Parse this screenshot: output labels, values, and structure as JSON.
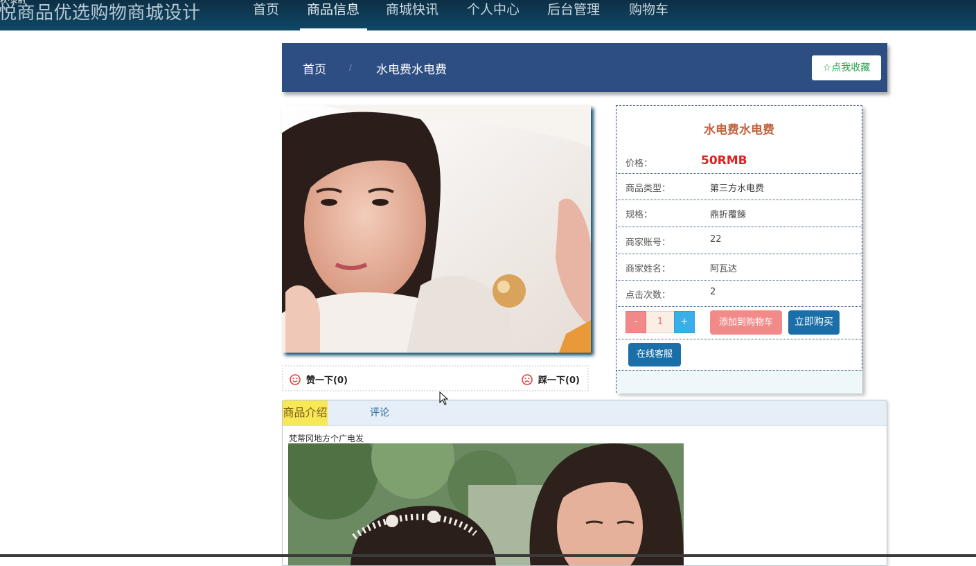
{
  "topbar": {
    "tiny_label": "秋·录制",
    "site_title": "悦商品优选购物商城设计",
    "nav": [
      {
        "label": "首页"
      },
      {
        "label": "商品信息"
      },
      {
        "label": "商城快讯"
      },
      {
        "label": "个人中心"
      },
      {
        "label": "后台管理"
      },
      {
        "label": "购物车"
      }
    ],
    "active_index": 1
  },
  "breadcrumb": {
    "home": "首页",
    "separator": "/",
    "current": "水电费水电费",
    "favorite_button": "☆点我收藏"
  },
  "votes": {
    "like": "赞一下(0)",
    "dislike": "踩一下(0)"
  },
  "product": {
    "title": "水电费水电费",
    "price_label": "价格：",
    "price_value": "50RMB",
    "fields": [
      {
        "label": "商品类型：",
        "value": "第三方水电费"
      },
      {
        "label": "规格：",
        "value": "鼎折覆餗"
      },
      {
        "label": "商家账号：",
        "value": "22"
      },
      {
        "label": "商家姓名：",
        "value": "阿瓦达"
      },
      {
        "label": "点击次数：",
        "value": "2"
      }
    ],
    "qty_minus": "-",
    "qty_value": "1",
    "qty_plus": "+",
    "add_to_cart": "添加到购物车",
    "buy_now": "立即购买",
    "online_service": "在线客服"
  },
  "tabs": {
    "intro_label": "商品介绍",
    "comment_label": "评论",
    "intro_text": "梵蒂冈地方个广电发"
  },
  "colors": {
    "nav_bg": "#0f4867",
    "crumb_bg": "#2d4e83",
    "price": "#e02020",
    "title": "#c0623c",
    "buy_btn": "#1a6fa8",
    "cart_btn": "#f28a8a",
    "tab_active": "#f8e858"
  }
}
